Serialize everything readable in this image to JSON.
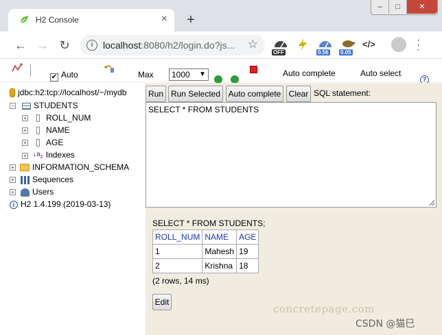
{
  "browser": {
    "tab_title": "H2 Console",
    "url_host": "localhost",
    "url_path": ":8080/h2/login.do?js...",
    "extensions": [
      {
        "name": "speed-off-icon",
        "badge": "OFF",
        "badge_color": "#333333"
      },
      {
        "name": "lightning-icon",
        "badge": "",
        "badge_color": ""
      },
      {
        "name": "speedometer-icon",
        "badge": "0.56",
        "badge_color": "#3b74d8"
      },
      {
        "name": "turtle-icon",
        "badge": "0.05",
        "badge_color": "#3b74d8"
      },
      {
        "name": "code-icon",
        "badge": "",
        "badge_color": ""
      }
    ]
  },
  "h2_toolbar": {
    "auto_commit_label": "Auto",
    "max_label": "Max",
    "max_value": "1000",
    "auto_complete_label": "Auto complete",
    "auto_select_label": "Auto select"
  },
  "tree": {
    "connection": "jdbc:h2:tcp://localhost/~/mydb",
    "table": "STUDENTS",
    "columns": [
      "ROLL_NUM",
      "NAME",
      "AGE"
    ],
    "indexes": "Indexes",
    "info_schema": "INFORMATION_SCHEMA",
    "sequences": "Sequences",
    "users": "Users",
    "version": "H2 1.4.199 (2019-03-13)"
  },
  "query": {
    "run": "Run",
    "run_selected": "Run Selected",
    "auto_complete": "Auto complete",
    "clear": "Clear",
    "sql_label": "SQL statement:",
    "sql_text": "SELECT * FROM STUDENTS"
  },
  "result": {
    "title": "SELECT * FROM STUDENTS;",
    "headers": [
      "ROLL_NUM",
      "NAME",
      "AGE"
    ],
    "rows": [
      [
        "1",
        "Mahesh",
        "19"
      ],
      [
        "2",
        "Krishna",
        "18"
      ]
    ],
    "meta": "(2 rows, 14 ms)",
    "edit": "Edit"
  },
  "watermarks": {
    "site": "concretepage.com",
    "csdn": "CSDN @猫巳"
  },
  "colors": {
    "accent_link": "#1b36b6",
    "panel_bg": "#f0ede0"
  }
}
